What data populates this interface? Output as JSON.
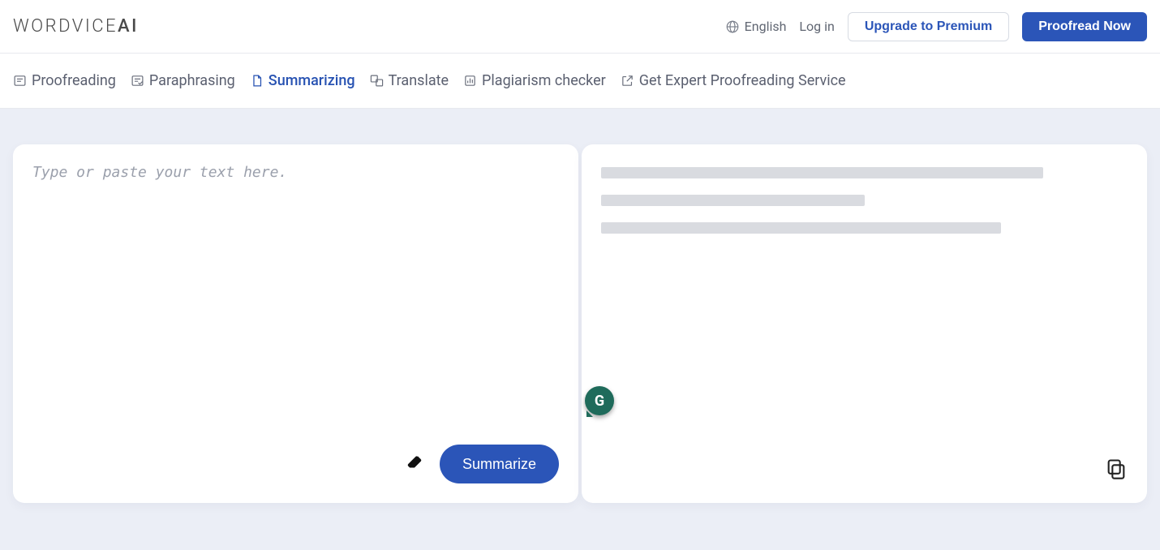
{
  "brand": {
    "name": "WORDVICE",
    "suffix": "AI"
  },
  "header": {
    "language": "English",
    "login": "Log in",
    "upgrade": "Upgrade to Premium",
    "proofread": "Proofread Now"
  },
  "tabs": {
    "proofreading": "Proofreading",
    "paraphrasing": "Paraphrasing",
    "summarizing": "Summarizing",
    "translate": "Translate",
    "plagiarism": "Plagiarism checker",
    "expert": "Get Expert Proofreading Service"
  },
  "editor": {
    "placeholder": "Type or paste your text here.",
    "summarize": "Summarize"
  },
  "badge": {
    "g": "G"
  }
}
